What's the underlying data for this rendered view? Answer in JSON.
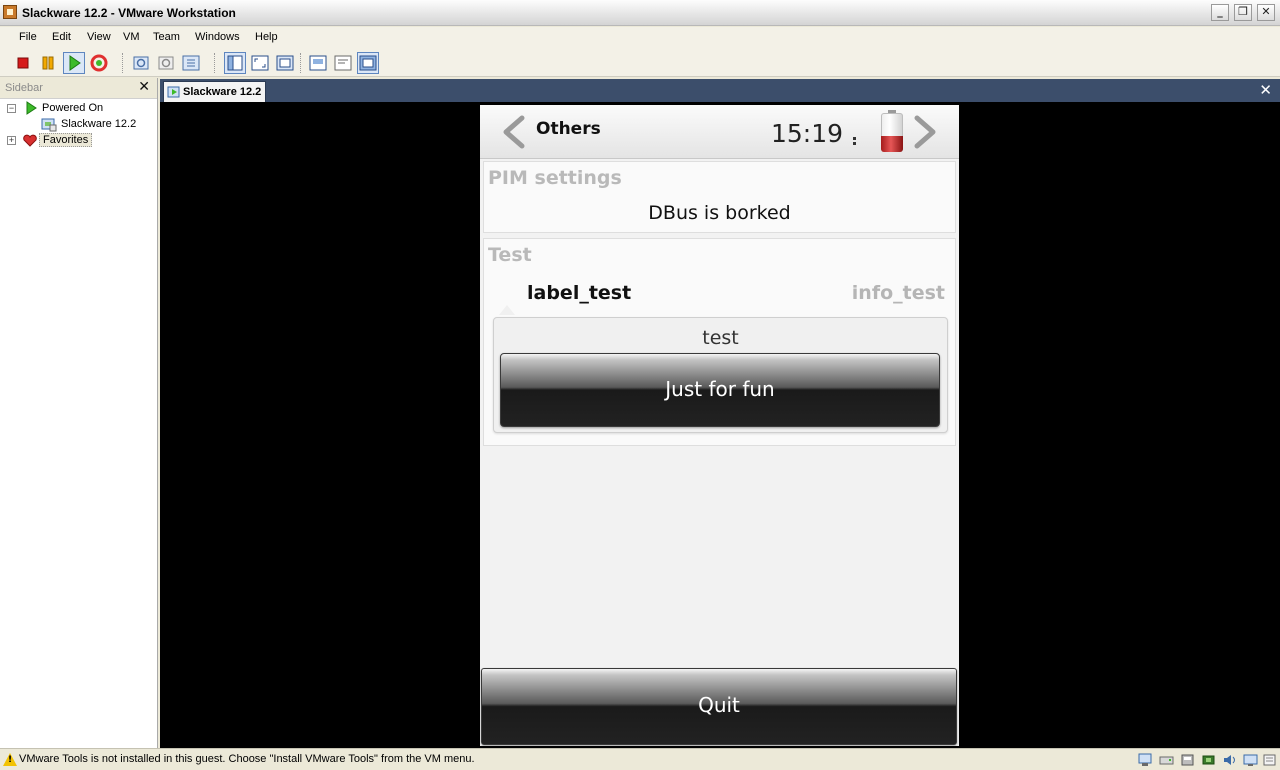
{
  "window": {
    "title": "Slackware 12.2 - VMware Workstation"
  },
  "menu": [
    "File",
    "Edit",
    "View",
    "VM",
    "Team",
    "Windows",
    "Help"
  ],
  "sidebar": {
    "header": "Sidebar",
    "close": "✕",
    "tree": [
      {
        "label": "Powered On",
        "expander": "−"
      },
      {
        "label": "Slackware 12.2"
      },
      {
        "label": "Favorites",
        "expander": "+"
      }
    ]
  },
  "vm_tabs": [
    {
      "label": "Slackware 12.2",
      "active": true
    }
  ],
  "tab_close": "✕",
  "phone": {
    "header": {
      "title": "Others",
      "clock": "15:19",
      "battery_level": 0.4
    },
    "pim": {
      "title": "PIM settings",
      "message": "DBus is borked"
    },
    "test": {
      "title": "Test",
      "label": "label_test",
      "info": "info_test",
      "bubble_text": "test",
      "button": "Just for fun"
    },
    "quit": "Quit"
  },
  "status": {
    "message": "VMware Tools is not installed in this guest. Choose \"Install VMware Tools\" from the VM menu.",
    "warning_glyph": "!"
  },
  "colors": {
    "tabstrip": "#3c4e6b",
    "vm_background": "#000000",
    "window_chrome": "#ece9d8"
  }
}
